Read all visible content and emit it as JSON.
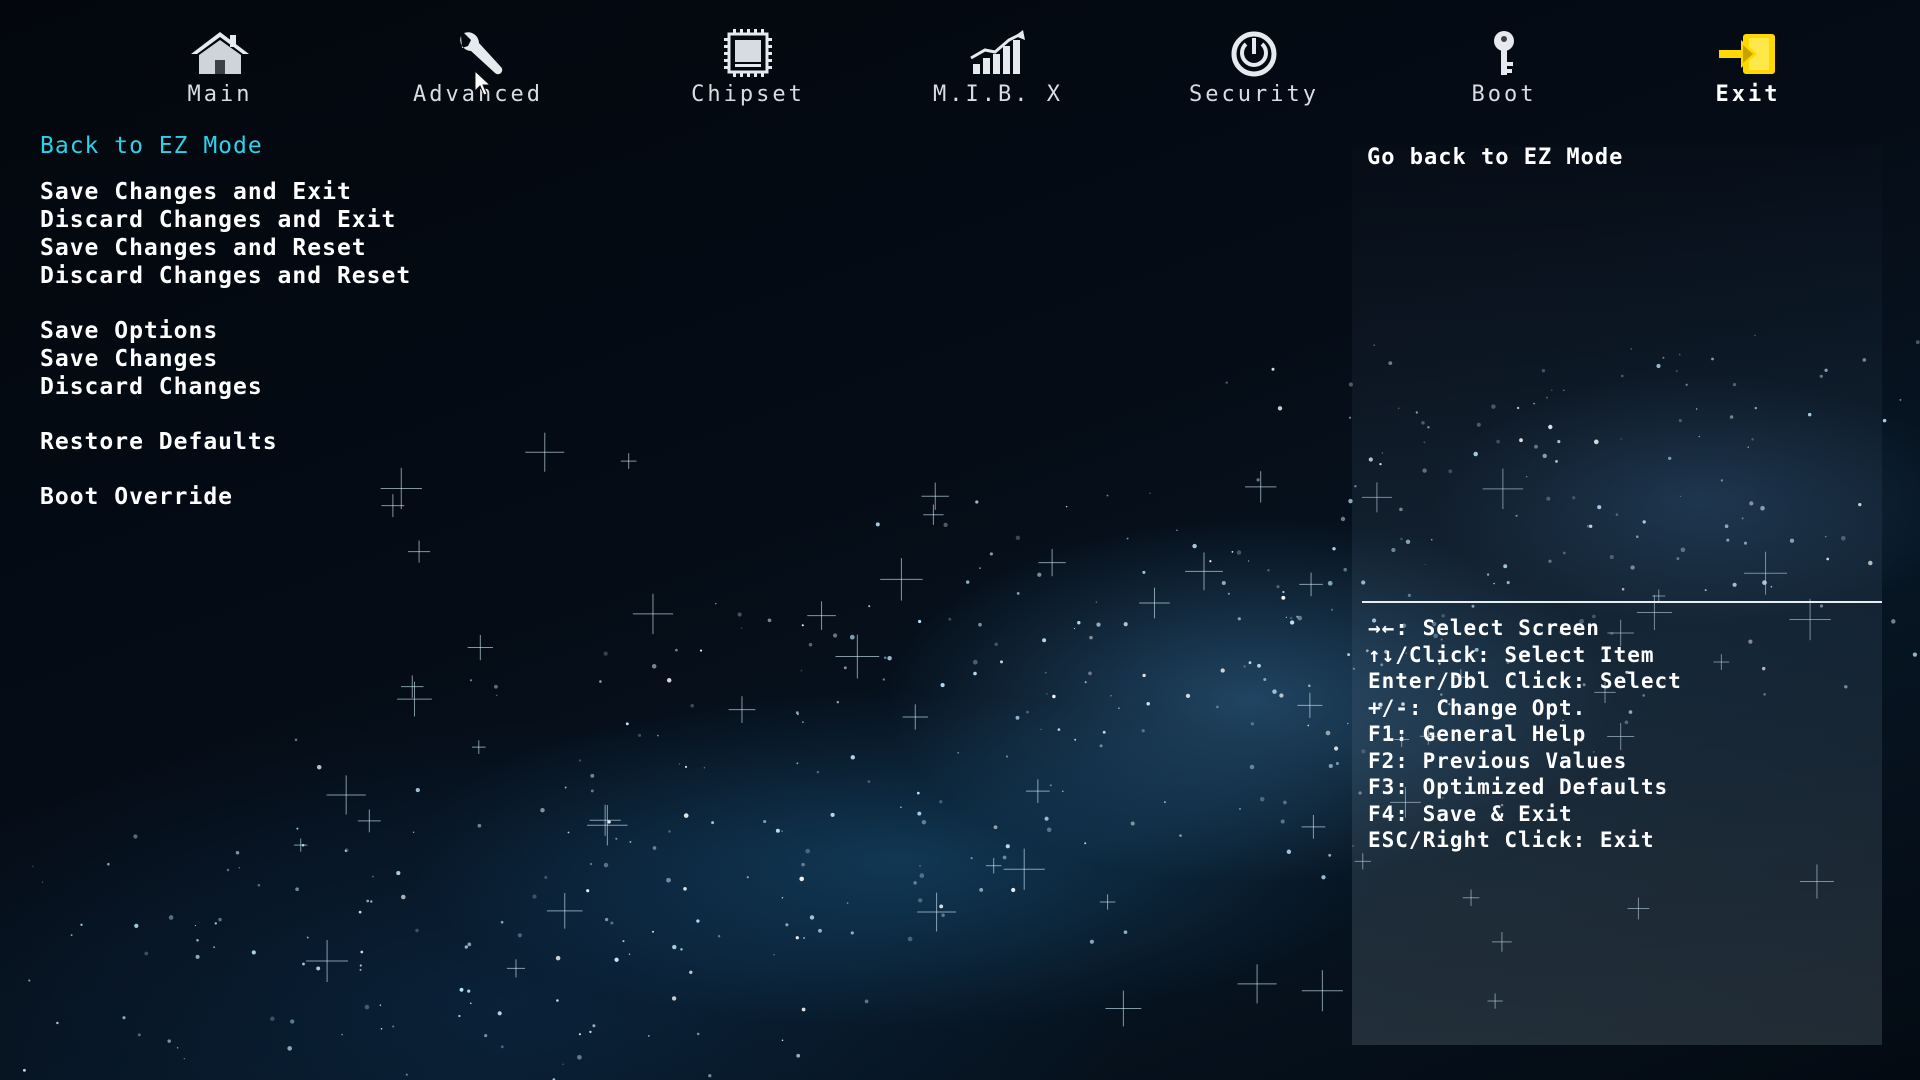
{
  "nav": {
    "tabs": [
      {
        "label": "Main",
        "icon": "home-icon"
      },
      {
        "label": "Advanced",
        "icon": "wrench-icon"
      },
      {
        "label": "Chipset",
        "icon": "chip-icon"
      },
      {
        "label": "M.I.B. X",
        "icon": "bar-chart-icon"
      },
      {
        "label": "Security",
        "icon": "power-shield-icon"
      },
      {
        "label": "Boot",
        "icon": "key-icon"
      },
      {
        "label": "Exit",
        "icon": "exit-door-icon",
        "active": true
      }
    ],
    "active_color": "#ffd800"
  },
  "menu": {
    "back_to_ez": "Back to EZ Mode",
    "save_exit": "Save Changes and Exit",
    "discard_exit": "Discard Changes and Exit",
    "save_reset": "Save Changes and Reset",
    "discard_reset": "Discard Changes and Reset",
    "save_options": "Save Options",
    "save_changes": "Save Changes",
    "discard_changes": "Discard Changes",
    "restore_defaults": "Restore Defaults",
    "boot_override": "Boot Override",
    "highlight_color": "#2bd3e8"
  },
  "help": {
    "description": "Go back to EZ Mode",
    "keys": [
      "→←: Select Screen",
      "↑↓/Click: Select Item",
      "Enter/Dbl Click: Select",
      "+/-: Change Opt.",
      "F1: General Help",
      "F2: Previous Values",
      "F3: Optimized Defaults",
      "F4: Save & Exit",
      "ESC/Right Click: Exit"
    ]
  }
}
